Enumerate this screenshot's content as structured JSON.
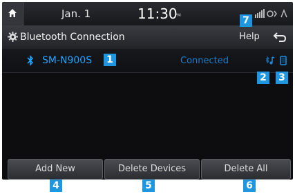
{
  "status_bar": {
    "date": "Jan.  1",
    "time": "11:30",
    "ampm": "PM"
  },
  "header": {
    "title": "Bluetooth Connection",
    "help_label": "Help",
    "back_icon": "back-arrow-icon",
    "settings_icon": "gear-icon"
  },
  "device": {
    "name": "SM-N900S",
    "status": "Connected",
    "audio_icon": "bluetooth-audio-icon",
    "phone_icon": "phone-icon"
  },
  "buttons": {
    "add_new": "Add New",
    "delete_devices": "Delete Devices",
    "delete_all": "Delete All"
  },
  "callouts": {
    "c1": "1",
    "c2": "2",
    "c3": "3",
    "c4": "4",
    "c5": "5",
    "c6": "6",
    "c7": "7"
  },
  "colors": {
    "accent": "#1fa2ff",
    "callout": "#1e97e0"
  }
}
